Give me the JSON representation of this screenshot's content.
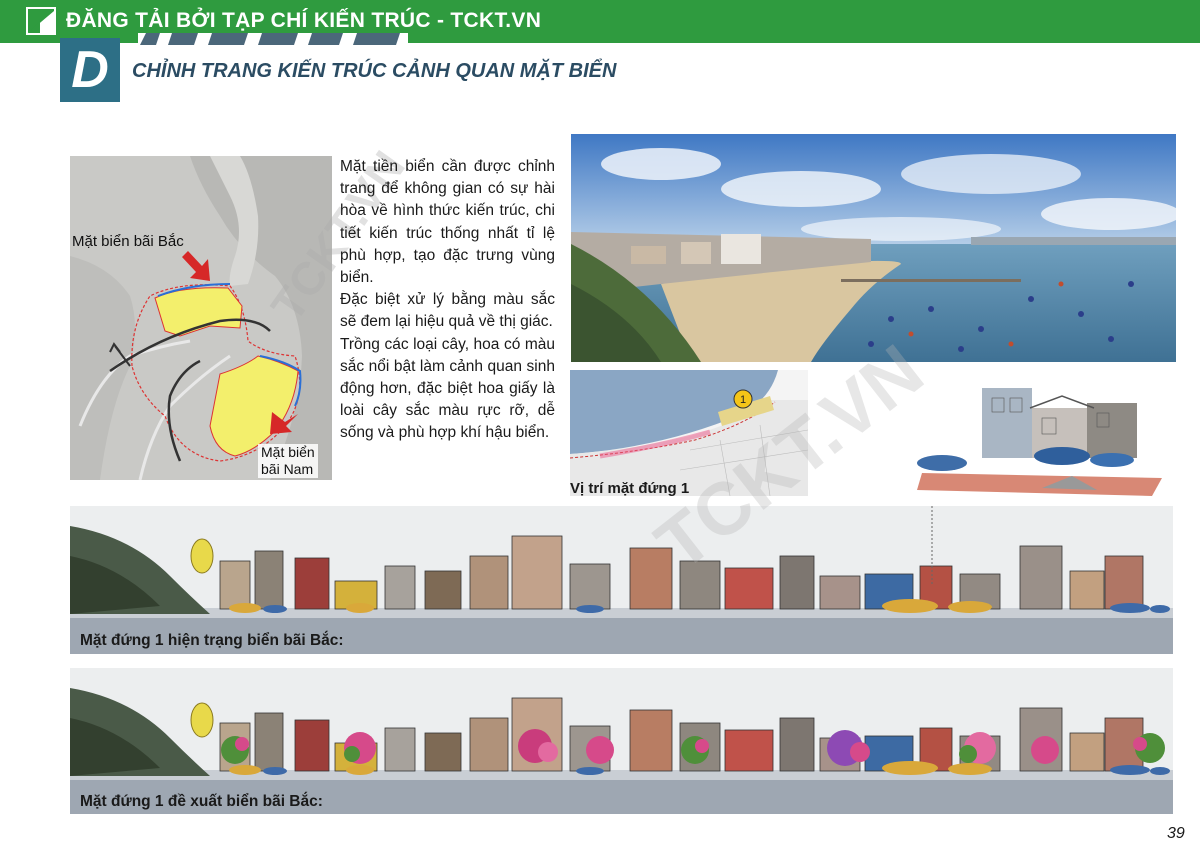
{
  "banner": {
    "text": "ĐĂNG TẢI BỞI TẠP CHÍ KIẾN TRÚC - TCKT.VN",
    "logo_icon": "tckt-logo-icon"
  },
  "section": {
    "letter": "D",
    "heading": "CHỈNH TRANG KIẾN TRÚC CẢNH QUAN MẶT BIỂN"
  },
  "map": {
    "label_north": "Mặt biển bãi Bắc",
    "label_south_line1": "Mặt biển",
    "label_south_line2": "bãi Nam"
  },
  "description": {
    "p1": "Mặt tiền biển cần được chỉnh trang để không gian có sự hài hòa về hình thức kiến trúc, chi tiết kiến trúc thống nhất tỉ lệ phù hợp, tạo đặc trưng vùng biển.",
    "p2": "Đặc biệt xử lý bằng màu sắc sẽ đem lại hiệu quả về thị giác.",
    "p3": "Trồng các loại cây, hoa có màu sắc nổi bật làm cảnh quan sinh động hơn, đặc biệt hoa giấy là loài cây sắc màu rực rỡ, dễ sống và phù hợp khí hậu biển."
  },
  "location": {
    "marker": "1",
    "caption": "Vị trí mặt đứng 1"
  },
  "elevations": {
    "current_caption": "Mặt đứng 1 hiện trạng biển bãi Bắc:",
    "proposed_caption": "Mặt đứng 1 đề xuất biển bãi Bắc:"
  },
  "page_number": "39",
  "watermark": "TCKT.VN",
  "colors": {
    "banner": "#2f9b3f",
    "section_box": "#2d6f86",
    "heading": "#2b4c63",
    "zone_fill": "#f3ef6c",
    "arrow": "#d62828"
  }
}
